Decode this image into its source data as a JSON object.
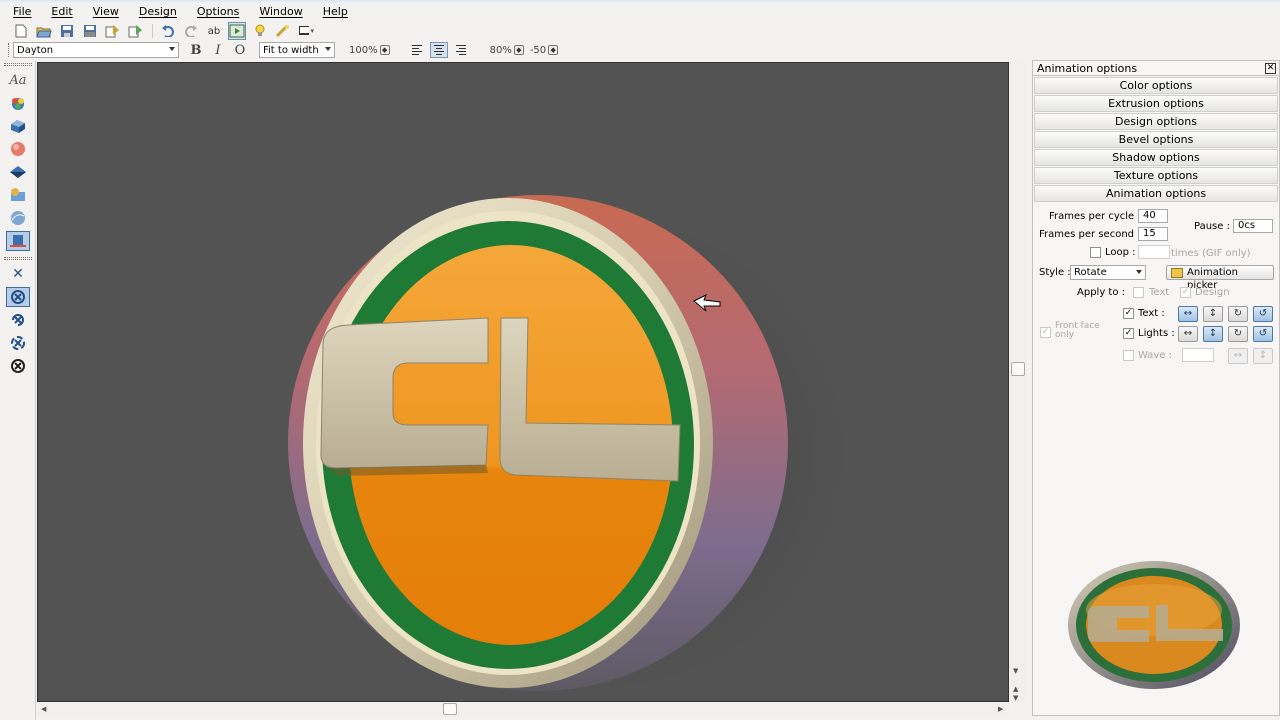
{
  "menubar": {
    "items": [
      {
        "key": "F",
        "rest": "ile"
      },
      {
        "key": "E",
        "rest": "dit"
      },
      {
        "key": "V",
        "rest": "iew"
      },
      {
        "key": "D",
        "rest": "esign"
      },
      {
        "key": "O",
        "rest": "ptions"
      },
      {
        "key": "W",
        "rest": "indow"
      },
      {
        "key": "H",
        "rest": "elp"
      }
    ]
  },
  "toolbar": {
    "icons": [
      "new-icon",
      "open-icon",
      "save-icon",
      "save-as-icon",
      "export-icon",
      "export-anim-icon",
      "undo-icon",
      "redo-icon",
      "spelling-icon",
      "animation-preview-icon",
      "lightbulb-icon",
      "lights-icon",
      "screen-icon"
    ]
  },
  "format": {
    "font": "Dayton",
    "bold": "B",
    "italic": "I",
    "outline": "O",
    "zoom_mode": "Fit to width",
    "font_size": "100%",
    "line_spacing": "80%",
    "char_spacing": "-50"
  },
  "canvas": {
    "logo_text": "CL",
    "background": "#535353",
    "ring_color": "#1e7a35",
    "face_color": "#ee8a10",
    "bevel_color": "#d8d0b6"
  },
  "panel": {
    "title": "Animation options",
    "sections": [
      "Color options",
      "Extrusion options",
      "Design options",
      "Bevel options",
      "Shadow options",
      "Texture options",
      "Animation options"
    ],
    "frames_per_cycle_label": "Frames per cycle :",
    "frames_per_cycle": "40",
    "frames_per_second_label": "Frames per second :",
    "frames_per_second": "15",
    "pause_label": "Pause :",
    "pause": "0cs",
    "loop_label": "Loop :",
    "loop_suffix": "times (GIF only)",
    "style_label": "Style :",
    "style_value": "Rotate",
    "picker_label": "Animation picker",
    "apply_label": "Apply to :",
    "apply_text": "Text",
    "apply_design": "Design",
    "text_label": "Text :",
    "lights_label": "Lights :",
    "wave_label": "Wave :",
    "front_face_label": "Front face only"
  }
}
